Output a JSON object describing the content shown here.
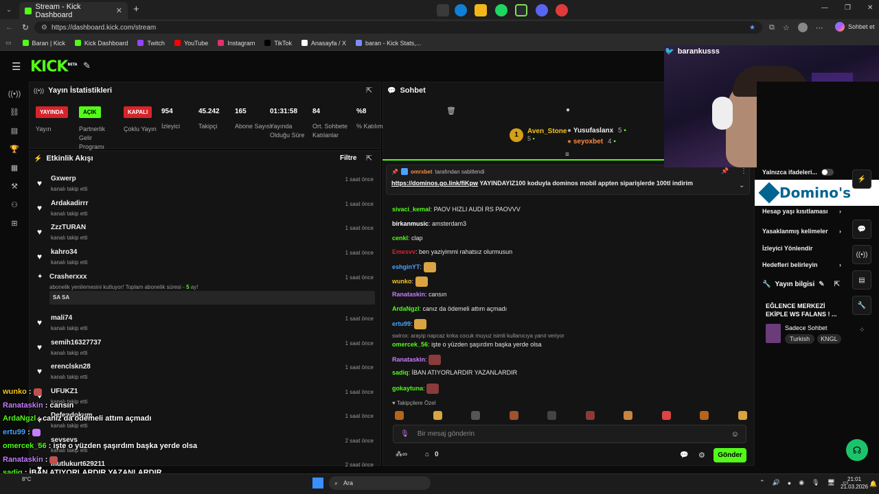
{
  "browser": {
    "tab_title": "Stream - Kick Dashboard",
    "new_tab": "+",
    "url": "https://dashboard.kick.com/stream",
    "sidebar_btn": "Sohbet et",
    "bookmarks": [
      {
        "label": "Baran | Kick",
        "color": "#53fc18"
      },
      {
        "label": "Kick Dashboard",
        "color": "#53fc18"
      },
      {
        "label": "Twitch",
        "color": "#9146ff"
      },
      {
        "label": "YouTube",
        "color": "#ff0000"
      },
      {
        "label": "Instagram",
        "color": "#e1306c"
      },
      {
        "label": "TikTok",
        "color": "#000000"
      },
      {
        "label": "Anasayfa / X",
        "color": "#ffffff"
      },
      {
        "label": "baran - Kick Stats,...",
        "color": "#7e8cff"
      }
    ]
  },
  "kick": {
    "logo": "KICK",
    "beta": "BETA"
  },
  "stats": {
    "title": "Yayın İstatistikleri",
    "badges": [
      {
        "text": "YAYINDA",
        "label": "Yayın",
        "bg": "#d6242b",
        "fg": "#ffffff"
      },
      {
        "text": "AÇIK",
        "label": "Partnerlik Gelir Programı",
        "bg": "#53fc18",
        "fg": "#000000"
      },
      {
        "text": "KAPALI",
        "label": "Çoklu Yayın",
        "bg": "#d6242b",
        "fg": "#ffffff"
      }
    ],
    "items": [
      {
        "value": "954",
        "label": "İzleyici"
      },
      {
        "value": "45.242",
        "label": "Takipçi"
      },
      {
        "value": "165",
        "label": "Abone Sayısı"
      },
      {
        "value": "01:31:58",
        "label": "Yayında Olduğu Süre"
      },
      {
        "value": "84",
        "label": "Ort. Sohbete Katılanlar"
      },
      {
        "value": "%8",
        "label": "% Katılım"
      }
    ]
  },
  "activity": {
    "title": "Etkinlik Akışı",
    "filter": "Filtre",
    "items": [
      {
        "name": "Gxwerp",
        "sub": "kanalı takip etti",
        "time": "1 saat önce"
      },
      {
        "name": "Ardakadirrr",
        "sub": "kanalı takip etti",
        "time": "1 saat önce"
      },
      {
        "name": "ZzzTURAN",
        "sub": "kanalı takip etti",
        "time": "1 saat önce"
      },
      {
        "name": "kahro34",
        "sub": "kanalı takip etti",
        "time": "1 saat önce"
      }
    ],
    "sub_event": {
      "name": "Crasherxxx",
      "sub": "abonelik yenilemesini kutluyor! Toplam abonelik süresi -",
      "months": "5",
      "suffix": "ay!",
      "time": "1 saat önce",
      "message": "SA SA"
    },
    "items2": [
      {
        "name": "mali74",
        "sub": "kanalı takip etti",
        "time": "1 saat önce"
      },
      {
        "name": "semih16327737",
        "sub": "kanalı takip etti",
        "time": "1 saat önce"
      },
      {
        "name": "erenclskn28",
        "sub": "kanalı takip etti",
        "time": "1 saat önce"
      },
      {
        "name": "UFUKZ1",
        "sub": "kanalı takip etti",
        "time": "1 saat önce"
      },
      {
        "name": "Defendokum",
        "sub": "kanalı takip etti",
        "time": "1 saat önce"
      },
      {
        "name": "sevsevs",
        "sub": "kanalı takip etti",
        "time": "2 saat önce"
      },
      {
        "name": "mutlukurt629211",
        "sub": "",
        "time": "2 saat önce"
      }
    ]
  },
  "chat": {
    "title": "Sohbet",
    "leaders": [
      {
        "rank": "1",
        "name": "Aven_Stone",
        "count": "5"
      },
      {
        "name": "Yusufaslanx",
        "count": "5"
      },
      {
        "name": "seyoxbet",
        "count": "4"
      }
    ],
    "pinned": {
      "by": "omrxbet",
      "by_suffix": "tarafından sabitlendi",
      "link": "https://dominos.go.link/fiKpw",
      "text": "YAYINDAYIZ100 koduyla dominos mobil appten siparişlerde 100tl indirim"
    },
    "messages": [
      {
        "user": "sivaci_kemal",
        "color": "#53fc18",
        "text": "PAOV HIZLI AUDİ RS PAOVVV"
      },
      {
        "user": "birkanmusic",
        "color": "#ffffff",
        "text": "amsterdam3"
      },
      {
        "user": "cenkl",
        "color": "#53fc18",
        "text": "clap"
      },
      {
        "user": "Emesvv",
        "color": "#d6242b",
        "text": "ben yaziyimmi rahatsız olurmusun"
      },
      {
        "user": "eshginYT",
        "color": "#4aa3ff",
        "text": ""
      },
      {
        "user": "wunko",
        "color": "#f5c518",
        "text": ""
      },
      {
        "user": "Ranataskin",
        "color": "#c77dff",
        "text": "cansın"
      },
      {
        "user": "ArdaNgzl",
        "color": "#53fc18",
        "text": "canız da ödemeli attım açmadı"
      },
      {
        "user": "ertu99",
        "color": "#4aa3ff",
        "text": ""
      },
      {
        "user": "omercek_56",
        "color": "#53fc18",
        "text": "işte o yüzden şaşırdım başka yerde olsa"
      },
      {
        "user": "Ranataskin",
        "color": "#c77dff",
        "text": ""
      },
      {
        "user": "sadiq",
        "color": "#53fc18",
        "text": "İBAN ATIYORLARDIR YAZANLARDIR"
      },
      {
        "user": "gokaytuna",
        "color": "#53fc18",
        "text": ""
      }
    ],
    "reply_note": "swirox: arayip napcaz knka cocuk muyuz isimli kullanıcıya yanıt veriyor",
    "followers_only": "Takipçilere Özel",
    "input_placeholder": "Bir mesaj gönderin",
    "points": "0",
    "send": "Gönder"
  },
  "side": {
    "streamer": "barankusss",
    "emotes_only": "Yalnızca ifadeleri...",
    "sponsor": "Domino's",
    "items": [
      "Hesap yaşı kısıtlaması",
      "Yasaklanmış kelimeler",
      "İzleyici Yönlendir",
      "Hedefleri belirleyin"
    ],
    "stream_info_title": "Yayın bilgisi",
    "stream_title": "EĞLENCE MERKEZİ EKİPLE WS FALANS ! ...",
    "category": "Sadece Sohbet",
    "tags": [
      "Turkish",
      "KNGL"
    ]
  },
  "overlay": [
    {
      "user": "wunko",
      "color": "#f5c518",
      "text": ""
    },
    {
      "user": "Ranataskin",
      "color": "#c77dff",
      "text": "cansın"
    },
    {
      "user": "ArdaNgzl",
      "color": "#53fc18",
      "text": "canız da ödemeli attım açmadı"
    },
    {
      "user": "ertu99",
      "color": "#4aa3ff",
      "text": ""
    },
    {
      "user": "omercek_56",
      "color": "#53fc18",
      "text": "işte o yüzden şaşırdım başka yerde olsa"
    },
    {
      "user": "Ranataskin",
      "color": "#c77dff",
      "text": ""
    },
    {
      "user": "sadiq",
      "color": "#53fc18",
      "text": "İBAN ATIYORLARDIR YAZANLARDIR"
    },
    {
      "user": "gokaytuna",
      "color": "#53fc18",
      "text": ""
    }
  ],
  "taskbar": {
    "search": "Ara",
    "time": "21:01",
    "date": "21.03.2026",
    "weather": "8°C"
  }
}
